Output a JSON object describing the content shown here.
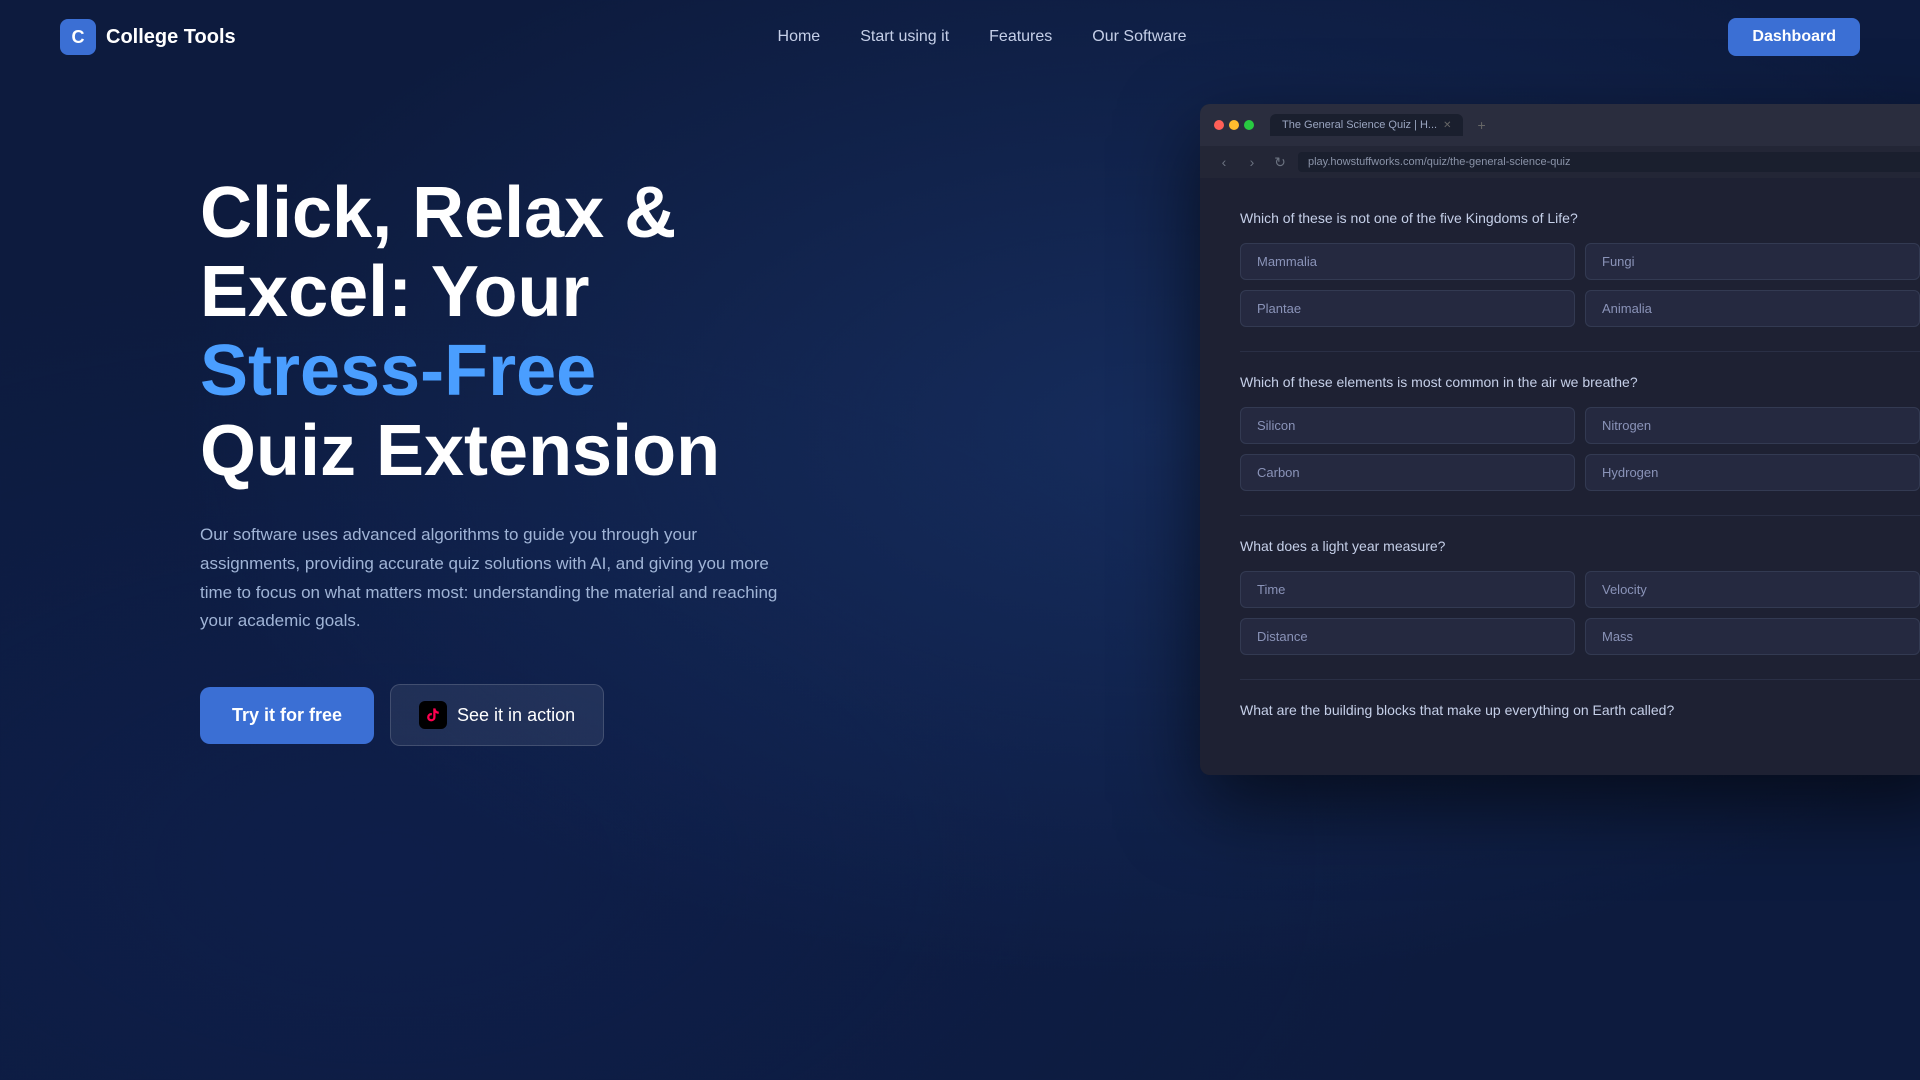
{
  "brand": {
    "name": "College Tools",
    "logo_letter": "C"
  },
  "nav": {
    "links": [
      {
        "id": "home",
        "label": "Home"
      },
      {
        "id": "start",
        "label": "Start using it"
      },
      {
        "id": "features",
        "label": "Features"
      },
      {
        "id": "software",
        "label": "Our Software"
      }
    ],
    "dashboard_label": "Dashboard"
  },
  "hero": {
    "headline_line1": "Click, Relax &",
    "headline_line2": "Excel: Your",
    "headline_highlight": "Stress-Free",
    "headline_line3": "Quiz Extension",
    "description": "Our software uses advanced algorithms to guide you through your assignments, providing accurate quiz solutions with AI, and giving you more time to focus on what matters most: understanding the material and reaching your academic goals.",
    "cta_primary": "Try it for free",
    "cta_secondary": "See it in action"
  },
  "browser": {
    "tab_title": "The General Science Quiz | H...",
    "url": "play.howstuffworks.com/quiz/the-general-science-quiz",
    "questions": [
      {
        "text": "Which of these is not one of the five Kingdoms of Life?",
        "answers": [
          {
            "label": "Mammalia",
            "selected": false
          },
          {
            "label": "Fungi",
            "selected": false
          },
          {
            "label": "Plantae",
            "selected": false
          },
          {
            "label": "Animalia",
            "selected": false
          }
        ]
      },
      {
        "text": "Which of these elements is most common in the air we breathe?",
        "answers": [
          {
            "label": "Silicon",
            "selected": false
          },
          {
            "label": "Nitrogen",
            "selected": false
          },
          {
            "label": "Carbon",
            "selected": false
          },
          {
            "label": "Hydrogen",
            "selected": false
          }
        ]
      },
      {
        "text": "What does a light year measure?",
        "answers": [
          {
            "label": "Time",
            "selected": false
          },
          {
            "label": "Velocity",
            "selected": false
          },
          {
            "label": "Distance",
            "selected": false
          },
          {
            "label": "Mass",
            "selected": false
          }
        ]
      },
      {
        "text": "What are the building blocks that make up everything on Earth called?",
        "answers": []
      }
    ]
  }
}
